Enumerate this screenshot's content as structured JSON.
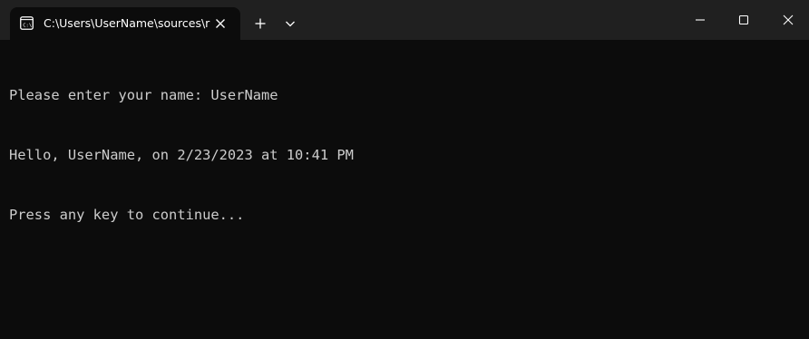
{
  "window": {
    "tab_title": "C:\\Users\\UserName\\sources\\r",
    "icons": {
      "tab": "terminal-icon",
      "tab_close": "close-icon",
      "new_tab": "plus-icon",
      "dropdown": "chevron-down-icon",
      "minimize": "minimize-icon",
      "maximize": "maximize-icon",
      "close": "close-icon"
    }
  },
  "console": {
    "lines": [
      "Please enter your name: UserName",
      "Hello, UserName, on 2/23/2023 at 10:41 PM",
      "Press any key to continue..."
    ]
  },
  "colors": {
    "background": "#0c0c0c",
    "titlebar": "#202020",
    "text": "#cccccc"
  }
}
